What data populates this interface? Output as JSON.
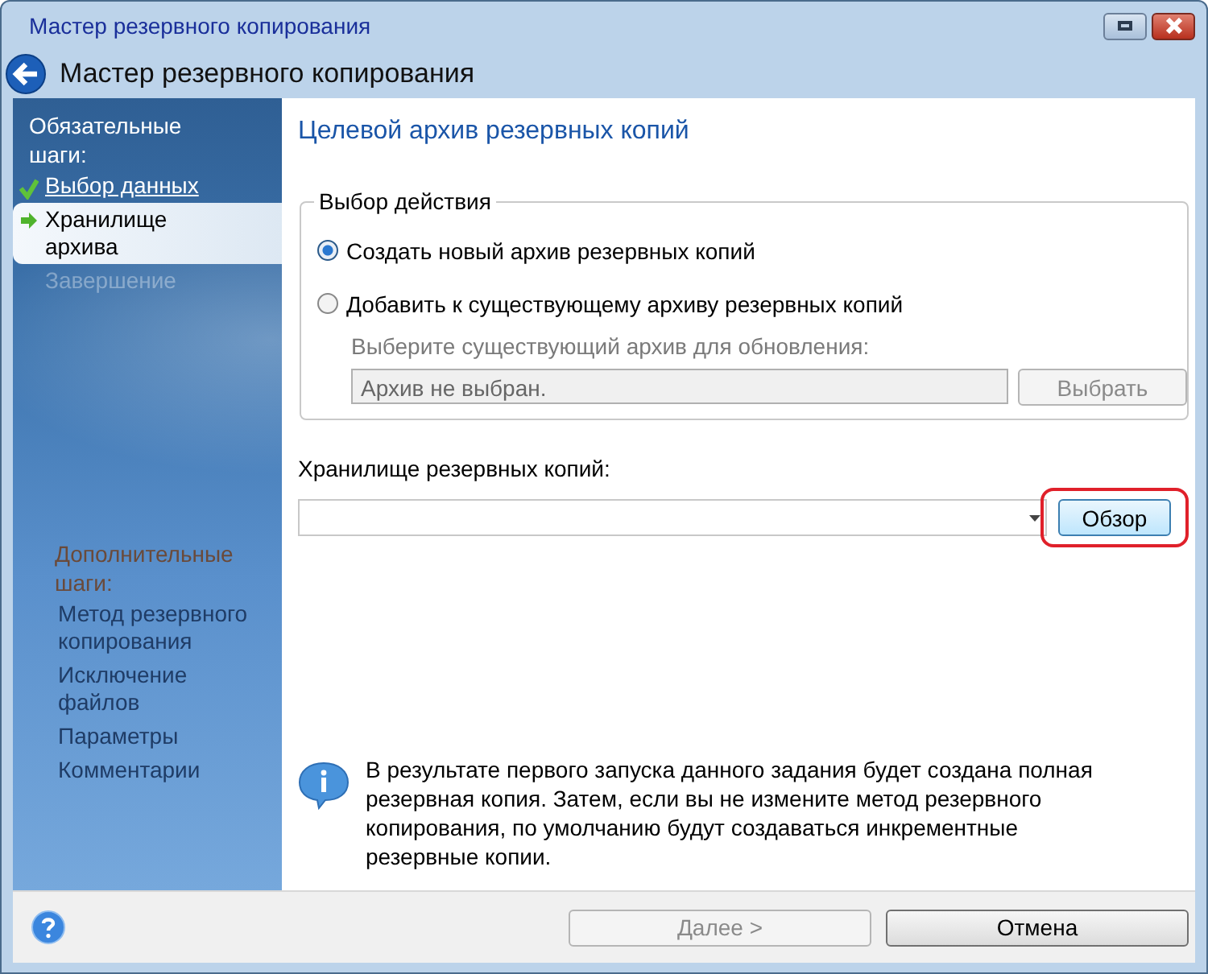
{
  "window": {
    "title": "Мастер резервного копирования"
  },
  "header": {
    "title": "Мастер резервного копирования"
  },
  "sidebar": {
    "sections": [
      {
        "title": "Обязательные шаги:",
        "enabled": true,
        "items": [
          {
            "label": "Выбор данных",
            "kind": "done",
            "selected": false
          },
          {
            "label": "Хранилище архива",
            "kind": "current",
            "selected": true
          },
          {
            "label": "Завершение",
            "kind": "pending",
            "selected": false
          }
        ]
      },
      {
        "title": "Дополнительные шаги:",
        "enabled": false,
        "items": [
          {
            "label": "Метод резервного копирования",
            "kind": "pending",
            "selected": false
          },
          {
            "label": "Исключение файлов",
            "kind": "pending",
            "selected": false
          },
          {
            "label": "Параметры",
            "kind": "pending",
            "selected": false
          },
          {
            "label": "Комментарии",
            "kind": "pending",
            "selected": false
          }
        ]
      }
    ]
  },
  "page_title": "Целевой архив резервных копий",
  "action_group": {
    "legend": "Выбор действия",
    "options": [
      {
        "label": "Создать новый архив резервных копий",
        "selected": true
      },
      {
        "label": "Добавить к существующему архиву резервных копий",
        "selected": false
      }
    ],
    "existing": {
      "label": "Выберите существующий архив для обновления:",
      "value": "Архив не выбран.",
      "button": "Выбрать",
      "disabled": true
    }
  },
  "storage": {
    "label": "Хранилище резервных копий:",
    "button": "Обзор",
    "highlighted": true
  },
  "info": "В результате первого запуска данного задания будет создана полная резервная копия. Затем, если вы не измените метод резервного копирования, по умолчанию будут создаваться инкрементные резервные копии.",
  "buttons": [
    {
      "label": "Далее >",
      "disabled": true
    },
    {
      "label": "Отмена",
      "disabled": false
    }
  ]
}
